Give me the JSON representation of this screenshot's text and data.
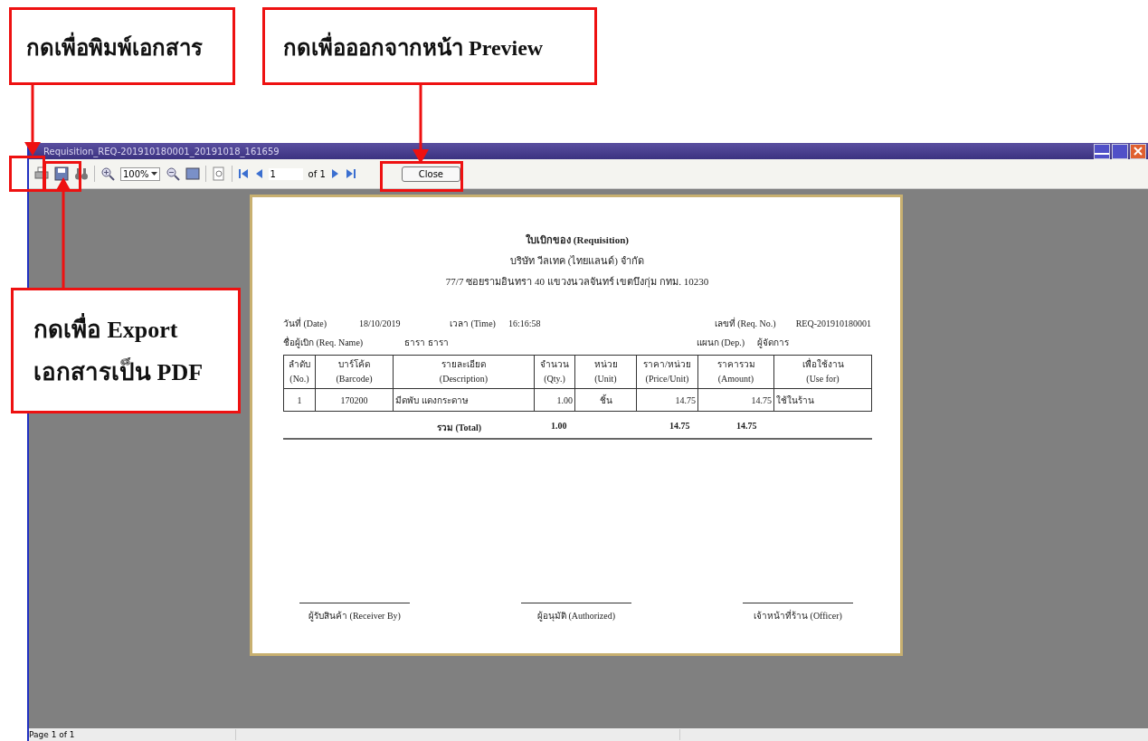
{
  "callouts": [
    {
      "lines": [
        "กดเพื่อพิมพ์เอกสาร"
      ]
    },
    {
      "lines": [
        "กดเพื่อออกจากหน้า Preview"
      ]
    },
    {
      "lines": [
        "กดเพื่อ Export",
        "เอกสารเป็น PDF"
      ]
    }
  ],
  "window": {
    "title": "Requisition_REQ-201910180001_20191018_161659"
  },
  "toolbar": {
    "zoom": "100%",
    "page": "1",
    "page_count": "of 1",
    "close": "Close"
  },
  "report": {
    "title": "ใบเบิกของ (Requisition)",
    "company": "บริษัท วีลเทค (ไทยแลนด์) จำกัด",
    "address": "77/7 ซอยรามอินทรา 40 แขวงนวลจันทร์ เขตบึงกุ่ม กทม. 10230",
    "fields": [
      {
        "label": "วันที่ (Date)",
        "value": "18/10/2019"
      },
      {
        "label": "เวลา (Time)",
        "value": "16:16:58"
      },
      {
        "label": "เลขที่ (Req. No.)",
        "value": "REQ-201910180001"
      },
      {
        "label": "ชื่อผู้เบิก (Req. Name)",
        "value": "ธารา ธารา"
      },
      {
        "label": "แผนก (Dep.)",
        "value": "ผู้จัดการ"
      }
    ],
    "header_rows": [
      [
        "ลำดับ",
        "บาร์โค้ด",
        "รายละเอียด",
        "จำนวน",
        "หน่วย",
        "ราคา/หน่วย",
        "ราคารวม",
        "เพื่อใช้งาน"
      ],
      [
        "(No.)",
        "(Barcode)",
        "(Description)",
        "(Qty.)",
        "(Unit)",
        "(Price/Unit)",
        "(Amount)",
        "(Use for)"
      ]
    ],
    "rows": [
      [
        "1",
        "170200",
        "มีดพับ แดงกระดาษ",
        "1.00",
        "ชิ้น",
        "14.75",
        "14.75",
        "ใช้ในร้าน"
      ]
    ],
    "total": {
      "label": "รวม (Total)",
      "qty": "1.00",
      "price": "14.75",
      "amount": "14.75"
    },
    "signatures": [
      "ผู้รับสินค้า (Receiver By)",
      "ผู้อนุมัติ (Authorized)",
      "เจ้าหน้าที่ร้าน (Officer)"
    ]
  },
  "status_bar": "Page 1 of 1"
}
